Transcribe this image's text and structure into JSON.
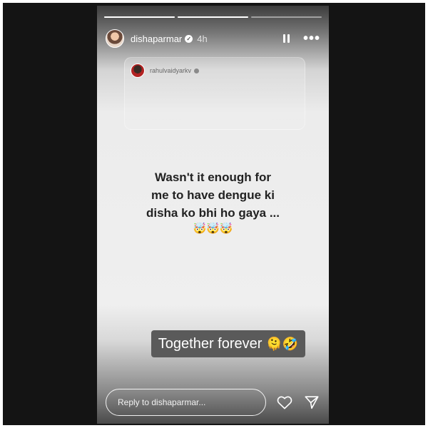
{
  "story": {
    "progress": [
      1.0,
      1.0,
      0.0
    ],
    "header": {
      "username": "dishaparmar",
      "verified_mark": "✓",
      "time": "4h",
      "pause_icon": "pause-icon",
      "more_icon": "more-dots-icon"
    },
    "shared_post": {
      "username": "rahulvaidyarkv"
    },
    "text_lines": [
      "Wasn't it enough for",
      "me to have dengue ki",
      "disha ko bhi ho gaya ..."
    ],
    "text_emojis": "🤯🤯🤯",
    "sticker": {
      "text": "Together forever",
      "emojis": "🫠🤣"
    },
    "reply": {
      "placeholder": "Reply to dishaparmar...",
      "like_icon": "heart-icon",
      "send_icon": "send-icon"
    }
  }
}
